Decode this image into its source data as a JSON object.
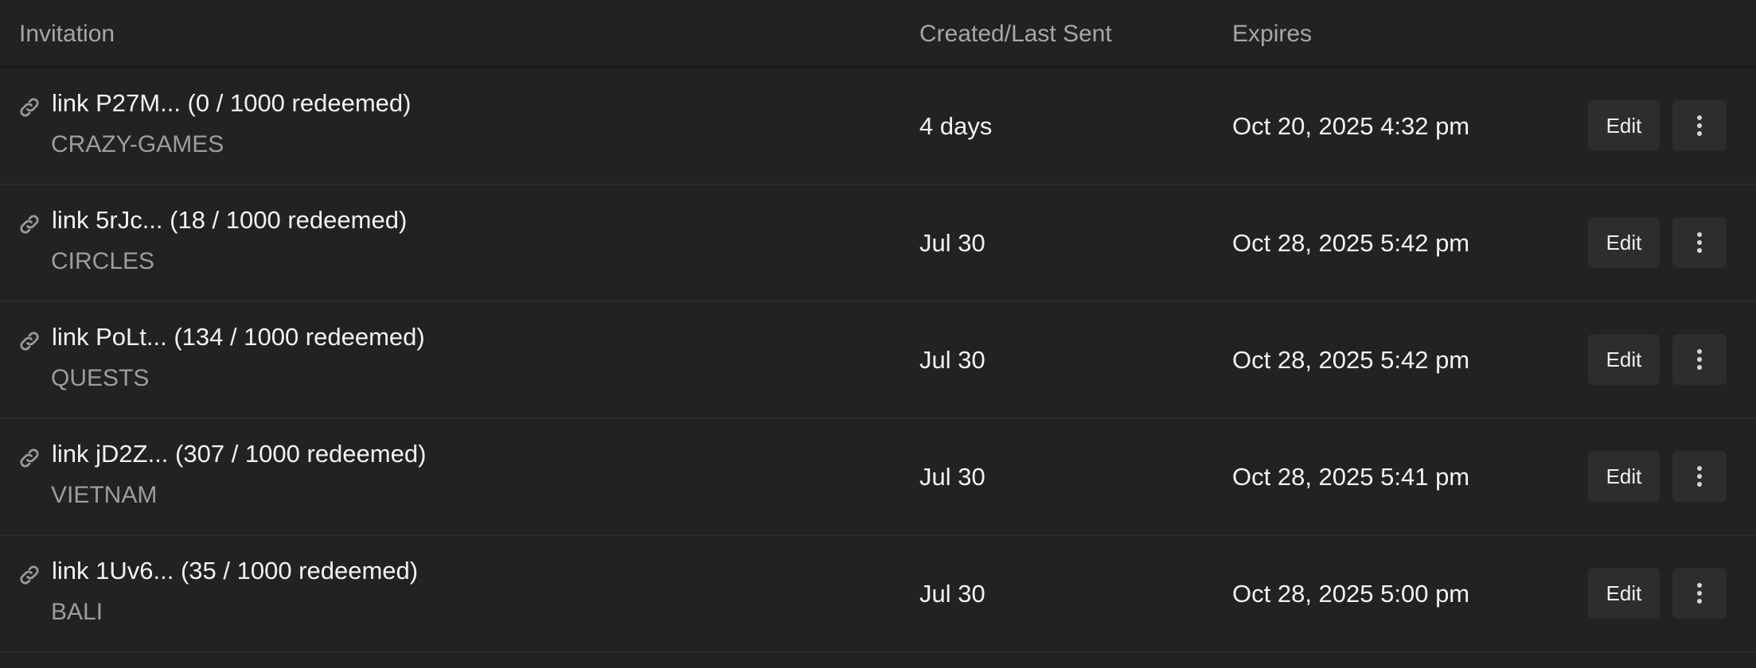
{
  "table": {
    "headers": {
      "invitation": "Invitation",
      "created": "Created/Last Sent",
      "expires": "Expires"
    },
    "rows": [
      {
        "title": "link P27M... (0 / 1000 redeemed)",
        "subtitle": "CRAZY-GAMES",
        "created": "4 days",
        "expires": "Oct 20, 2025 4:32 pm",
        "edit_label": "Edit"
      },
      {
        "title": "link 5rJc... (18 / 1000 redeemed)",
        "subtitle": "CIRCLES",
        "created": "Jul 30",
        "expires": "Oct 28, 2025 5:42 pm",
        "edit_label": "Edit"
      },
      {
        "title": "link PoLt... (134 / 1000 redeemed)",
        "subtitle": "QUESTS",
        "created": "Jul 30",
        "expires": "Oct 28, 2025 5:42 pm",
        "edit_label": "Edit"
      },
      {
        "title": "link jD2Z... (307 / 1000 redeemed)",
        "subtitle": "VIETNAM",
        "created": "Jul 30",
        "expires": "Oct 28, 2025 5:41 pm",
        "edit_label": "Edit"
      },
      {
        "title": "link 1Uv6... (35 / 1000 redeemed)",
        "subtitle": "BALI",
        "created": "Jul 30",
        "expires": "Oct 28, 2025 5:00 pm",
        "edit_label": "Edit"
      }
    ]
  },
  "icons": {
    "row_icon": "link-icon",
    "menu_icon": "more-vertical-icon"
  },
  "colors": {
    "background": "#222222",
    "button_bg": "#2d2d2d",
    "header_text": "#a7a7a7",
    "primary_text": "#f2f2f2",
    "secondary_text": "#9d9d9d"
  }
}
